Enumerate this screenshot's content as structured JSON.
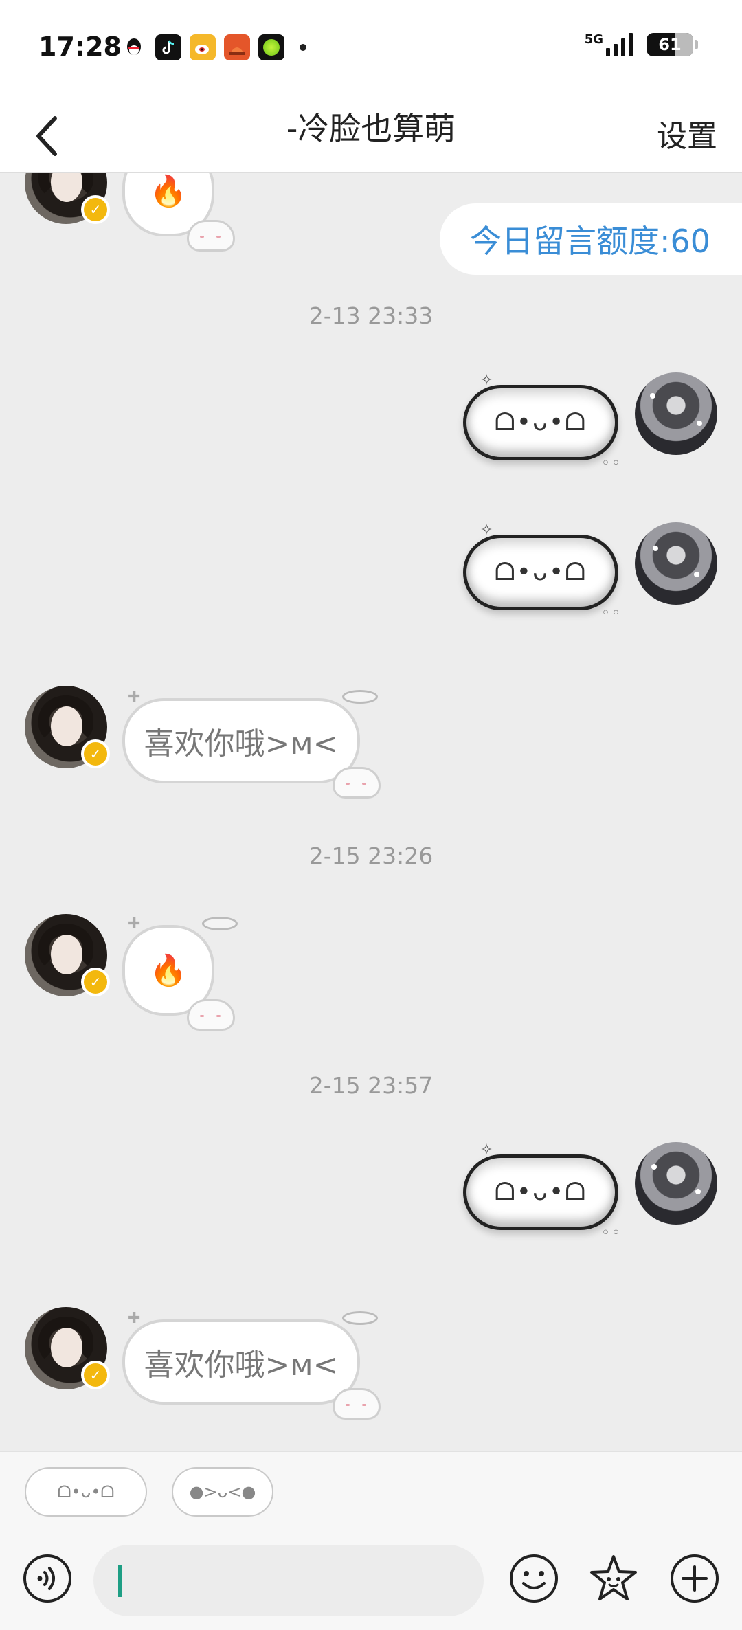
{
  "status_bar": {
    "time": "17:28",
    "network": "5G",
    "battery": "61",
    "battery_level": 0.61,
    "app_icons": [
      "qq-icon",
      "tiktok-icon",
      "weibo-icon",
      "game-icon",
      "green-app-icon"
    ]
  },
  "nav": {
    "title": "-冷脸也算萌",
    "settings_label": "设置"
  },
  "quota": {
    "label": "今日留言额度:60"
  },
  "messages": [
    {
      "side": "left",
      "kind": "emoji",
      "content": "🔥"
    },
    {
      "kind": "timestamp",
      "content": "2-13 23:33"
    },
    {
      "side": "right",
      "kind": "kaomoji",
      "content": "ᗝ•ᴗ•ᗝ"
    },
    {
      "side": "right",
      "kind": "kaomoji",
      "content": "ᗝ•ᴗ•ᗝ"
    },
    {
      "side": "left",
      "kind": "text",
      "content": "喜欢你哦>ᴍ<"
    },
    {
      "kind": "timestamp",
      "content": "2-15 23:26"
    },
    {
      "side": "left",
      "kind": "emoji",
      "content": "🔥"
    },
    {
      "kind": "timestamp",
      "content": "2-15 23:57"
    },
    {
      "side": "right",
      "kind": "kaomoji",
      "content": "ᗝ•ᴗ•ᗝ"
    },
    {
      "side": "left",
      "kind": "text",
      "content": "喜欢你哦>ᴍ<"
    }
  ],
  "quick_replies": [
    "ᗝ•ᴗ•ᗝ",
    "●>ᴗ<●"
  ],
  "input": {
    "value": "",
    "icons": [
      "voice-icon",
      "emoji-icon",
      "sticker-icon",
      "plus-icon"
    ]
  },
  "colors": {
    "accent_blue": "#3a8dd6",
    "verified_badge": "#f3b80e",
    "caret_green": "#1e9e84",
    "chat_background": "#ededed"
  }
}
